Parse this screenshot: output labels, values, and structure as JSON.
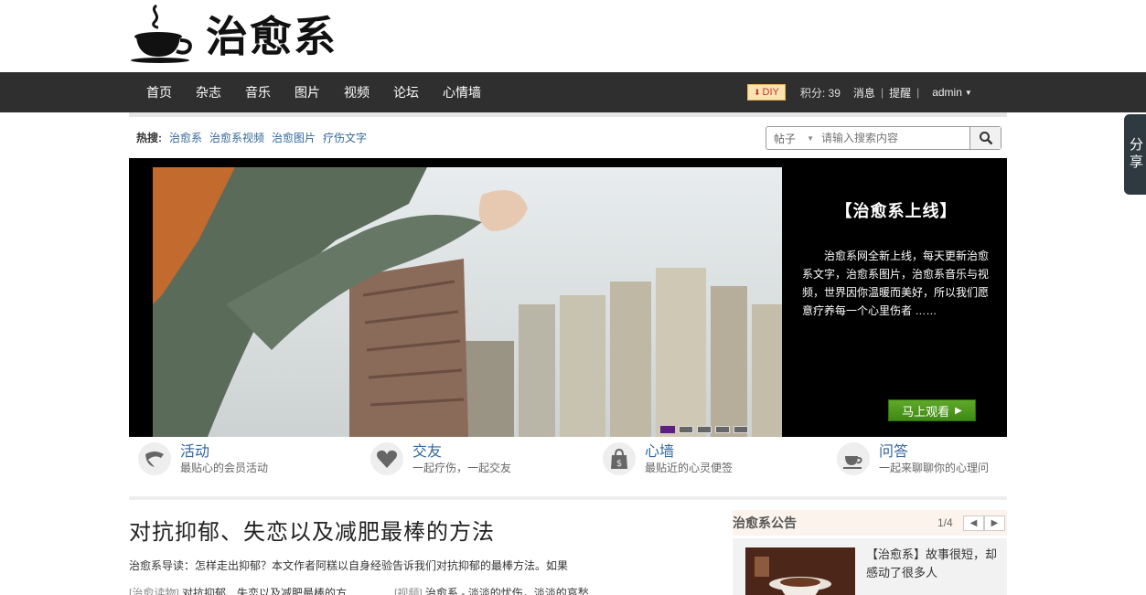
{
  "logo": {
    "text": "治愈系"
  },
  "nav": {
    "items": [
      "首页",
      "杂志",
      "音乐",
      "图片",
      "视频",
      "论坛",
      "心情墙"
    ],
    "diy_label": "DIY",
    "credits": "积分: 39",
    "messages": "消息",
    "reminders": "提醒",
    "separator": "|",
    "user": "admin"
  },
  "hot_search": {
    "label": "热搜:",
    "tags": [
      "治愈系",
      "治愈系视频",
      "治愈图片",
      "疗伤文字"
    ]
  },
  "search": {
    "type": "帖子",
    "placeholder": "请输入搜索内容"
  },
  "banner": {
    "title": "【治愈系上线】",
    "description": "治愈系网全新上线，每天更新治愈系文字，治愈系图片，治愈系音乐与视频，世界因你温暖而美好，所以我们愿意疗养每一个心里伤者 ……",
    "button_label": "马上观看",
    "slide_count": 5,
    "active_slide": 1
  },
  "features": [
    {
      "title": "活动",
      "desc": "最贴心的会员活动",
      "icon": "ribbon-icon"
    },
    {
      "title": "交友",
      "desc": "一起疗伤，一起交友",
      "icon": "heart-icon"
    },
    {
      "title": "心墙",
      "desc": "最贴近的心灵便签",
      "icon": "shopping-bag-icon"
    },
    {
      "title": "问答",
      "desc": "一起来聊聊你的心理问",
      "icon": "coffee-cup-icon"
    }
  ],
  "article": {
    "title": "对抗抑郁、失恋以及减肥最棒的方法",
    "intro": "治愈系导读：怎样走出抑郁？本文作者阿糕以自身经验告诉我们对抗抑郁的最棒方法。如果",
    "links": [
      {
        "category": "[治愈读物]",
        "text": "对抗抑郁、失恋以及减肥最棒的方…"
      },
      {
        "category": "[视频]",
        "text": "治愈系 - 淡淡的忧伤，淡淡的哀愁"
      }
    ]
  },
  "notice": {
    "title": "治愈系公告",
    "page": "1/4",
    "text": "【治愈系】故事很短，却感动了很多人"
  },
  "share": {
    "label": "分享"
  },
  "colors": {
    "nav_bg": "#2f2f2f",
    "link": "#336699",
    "banner_button": "#4e9a1e",
    "active_dot": "#5d1f86"
  }
}
